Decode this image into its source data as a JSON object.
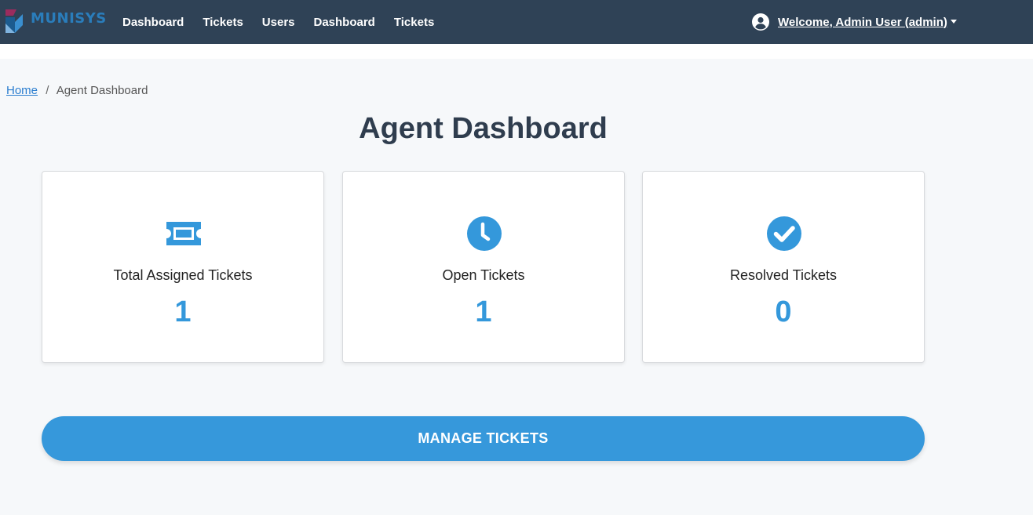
{
  "navbar": {
    "brand": "MUNISYS",
    "links": [
      "Dashboard",
      "Tickets",
      "Users",
      "Dashboard",
      "Tickets"
    ],
    "user_label": "Welcome, Admin User (admin)"
  },
  "breadcrumb": {
    "home": "Home",
    "separator": "/",
    "current": "Agent Dashboard"
  },
  "page": {
    "title": "Agent Dashboard"
  },
  "stats": [
    {
      "icon": "ticket-icon",
      "label": "Total Assigned Tickets",
      "value": "1"
    },
    {
      "icon": "clock-icon",
      "label": "Open Tickets",
      "value": "1"
    },
    {
      "icon": "check-circle-icon",
      "label": "Resolved Tickets",
      "value": "0"
    }
  ],
  "actions": {
    "manage_label": "MANAGE TICKETS"
  },
  "colors": {
    "navbar": "#2f4256",
    "accent": "#3498db",
    "title": "#2f3d4e"
  }
}
